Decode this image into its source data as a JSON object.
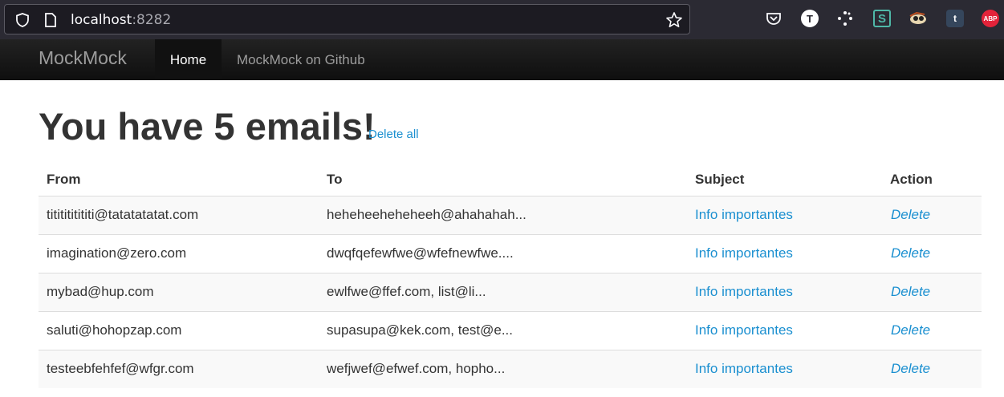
{
  "browser": {
    "url_host": "localhost",
    "url_port": ":8282",
    "extensions": [
      "pocket-icon",
      "t-avatar-icon",
      "dots-icon",
      "s-icon",
      "bird-icon",
      "tumblr-icon",
      "adblock-icon"
    ],
    "t_avatar_label": "T",
    "tumblr_label": "t",
    "abp_label": "ABP"
  },
  "navbar": {
    "brand": "MockMock",
    "items": [
      {
        "label": "Home"
      },
      {
        "label": "MockMock on Github"
      }
    ]
  },
  "main": {
    "title": "You have 5 emails!",
    "delete_all": "Delete all",
    "columns": [
      "From",
      "To",
      "Subject",
      "Action"
    ],
    "rows": [
      {
        "from": "tititititititi@tatatatatat.com",
        "to": "heheheeheheheeh@ahahahah...",
        "subject": "Info importantes",
        "action": "Delete"
      },
      {
        "from": "imagination@zero.com",
        "to": "dwqfqefewfwe@wfefnewfwe....",
        "subject": "Info importantes",
        "action": "Delete"
      },
      {
        "from": "mybad@hup.com",
        "to": "ewlfwe@ffef.com, list@li...",
        "subject": "Info importantes",
        "action": "Delete"
      },
      {
        "from": "saluti@hohopzap.com",
        "to": "supasupa@kek.com, test@e...",
        "subject": "Info importantes",
        "action": "Delete"
      },
      {
        "from": "testeebfehfef@wfgr.com",
        "to": "wefjwef@efwef.com, hopho...",
        "subject": "Info importantes",
        "action": "Delete"
      }
    ]
  },
  "colors": {
    "link": "#1a8fd0",
    "navbar_bg": "#1a1a1a",
    "browser_bg": "#2b2a33"
  }
}
